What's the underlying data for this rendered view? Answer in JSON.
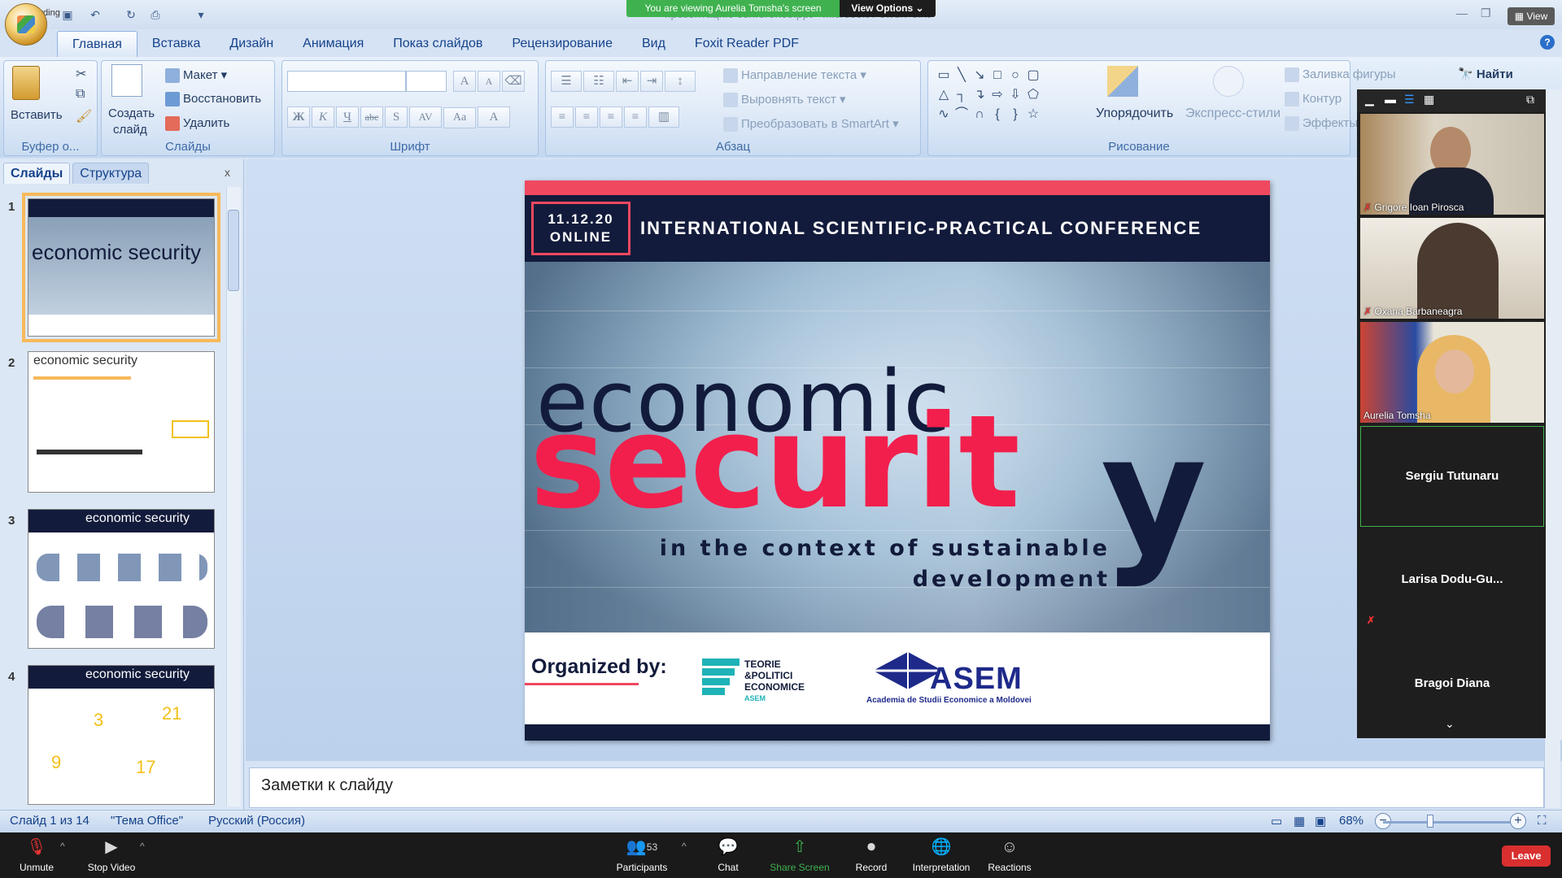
{
  "window": {
    "doc_title": "презентацию conference.ppt - Microsoft PowerPoint",
    "recording_label": "Recording",
    "view_button": "View"
  },
  "zoom_banner": {
    "viewing": "You are viewing Aurelia Tomsha's screen",
    "view_options": "View Options"
  },
  "ribbon": {
    "tabs": [
      "Главная",
      "Вставка",
      "Дизайн",
      "Анимация",
      "Показ слайдов",
      "Рецензирование",
      "Вид",
      "Foxit Reader PDF"
    ],
    "clipboard": {
      "paste": "Вставить",
      "label": "Буфер о..."
    },
    "slides": {
      "create": "Создать",
      "create2": "слайд",
      "layout": "Макет",
      "reset": "Восстановить",
      "delete": "Удалить",
      "label": "Слайды"
    },
    "font": {
      "label": "Шрифт",
      "bold": "Ж",
      "italic": "К",
      "underline": "Ч",
      "strike": "abc",
      "shadow": "S",
      "spacing": "AV",
      "case": "Aa",
      "color": "A",
      "grow": "A",
      "shrink": "A"
    },
    "paragraph": {
      "label": "Абзац",
      "direction": "Направление текста",
      "align": "Выровнять текст",
      "smartart": "Преобразовать в SmartArt"
    },
    "drawing": {
      "label": "Рисование",
      "arrange": "Упорядочить",
      "styles": "Экспресс-стили",
      "fill": "Заливка фигуры",
      "outline": "Контур",
      "effects": "Эффекты"
    },
    "editing": {
      "find": "Найти"
    }
  },
  "left_pane": {
    "tabs": [
      "Слайды",
      "Структура"
    ],
    "close": "x",
    "thumbs": [
      {
        "num": "1",
        "title": "economic security"
      },
      {
        "num": "2",
        "title": "economic security"
      },
      {
        "num": "3",
        "title": "economic security"
      },
      {
        "num": "4",
        "title": "economic security"
      }
    ]
  },
  "slide": {
    "date": "11.12.20",
    "mode": "ONLINE",
    "conference": "INTERNATIONAL  SCIENTIFIC-PRACTICAL CONFERENCE",
    "word1": "economic",
    "word2": "securit",
    "word2_last": "y",
    "context1": "in the context of sustainable",
    "context2": "development",
    "organized_by": "Organized by:",
    "tpe": [
      "TEORIE",
      "&POLITICI",
      "ECONOMICE",
      "ASEM"
    ],
    "asem": "ASEM",
    "asem_sub": "Academia de Studii Economice a Moldovei"
  },
  "notes": {
    "placeholder": "Заметки к слайду"
  },
  "status": {
    "slide": "Слайд 1 из 14",
    "theme": "\"Тема Office\"",
    "lang": "Русский (Россия)",
    "zoom": "68%"
  },
  "participants_panel": {
    "videos": [
      {
        "name": "Grigore Ioan Pirosca"
      },
      {
        "name": "Oxana Barbaneagra"
      },
      {
        "name": "Aurelia Tomsha"
      }
    ],
    "names_only": [
      "Sergiu Tutunaru",
      "Larisa  Dodu-Gu...",
      "Bragoi Diana"
    ]
  },
  "zoom_toolbar": {
    "unmute": "Unmute",
    "stop_video": "Stop Video",
    "participants": "Participants",
    "participants_count": "53",
    "chat": "Chat",
    "share": "Share Screen",
    "record": "Record",
    "interpretation": "Interpretation",
    "reactions": "Reactions",
    "leave": "Leave"
  },
  "colors": {
    "accent_red": "#f0485f",
    "navy": "#121b3b",
    "share_green": "#3fb24f",
    "leave_red": "#d92f2f"
  }
}
